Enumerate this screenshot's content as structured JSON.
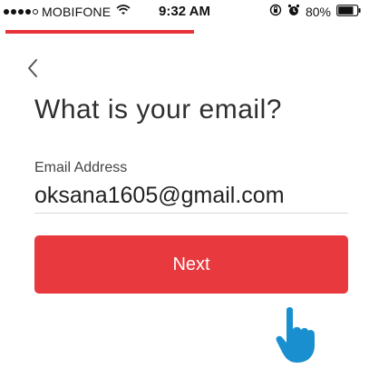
{
  "status_bar": {
    "carrier": "MOBIFONE",
    "time": "9:32 AM",
    "battery_percent": "80%",
    "signal_icon": "signal-dots-icon",
    "wifi_icon": "wifi-icon",
    "orientation_lock_icon": "orientation-lock-icon",
    "alarm_icon": "alarm-icon",
    "battery_icon": "battery-icon",
    "battery_level": 0.8
  },
  "progress": {
    "fraction": 0.5,
    "color": "#e8333a"
  },
  "nav": {
    "back_icon": "chevron-left-icon"
  },
  "page": {
    "title": "What is your email?"
  },
  "form": {
    "email_label": "Email Address",
    "email_value": "oksana1605@gmail.com"
  },
  "actions": {
    "next_label": "Next",
    "accent_color": "#e8393e"
  },
  "cursor": {
    "icon": "hand-pointer-icon",
    "color": "#1a8fd0"
  }
}
